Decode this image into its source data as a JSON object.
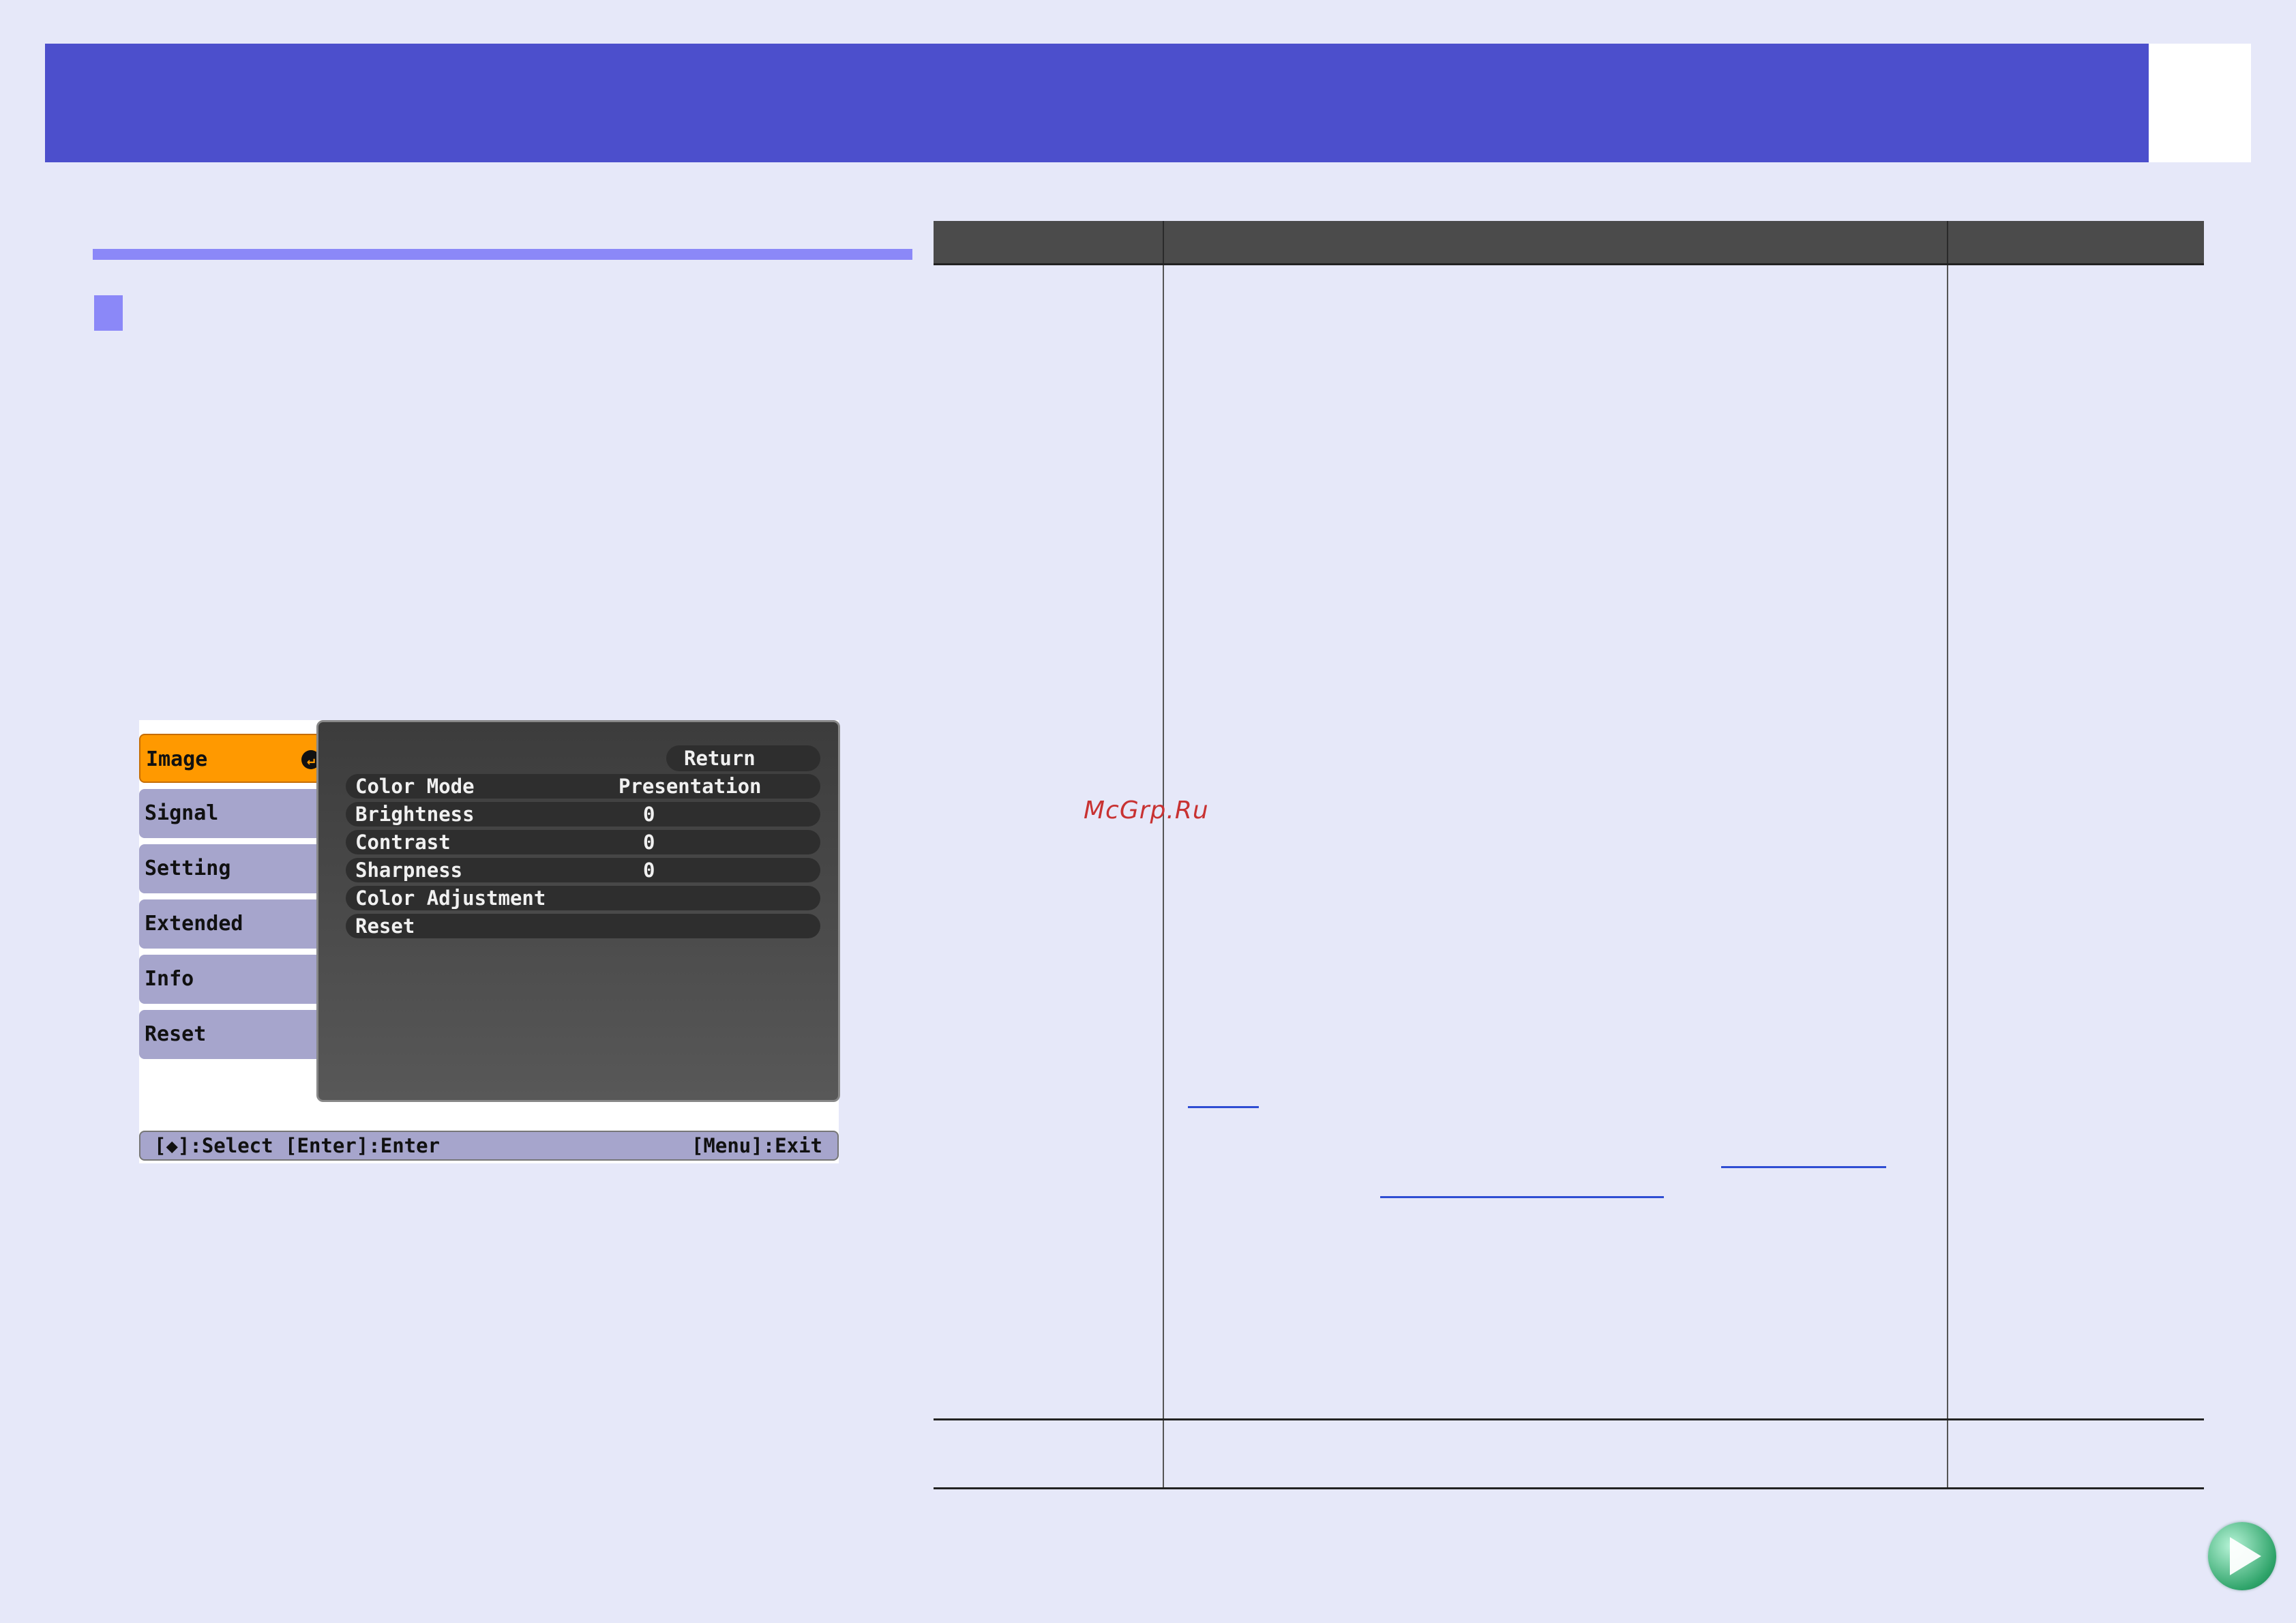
{
  "menu": {
    "nav": [
      {
        "label": "Image"
      },
      {
        "label": "Signal"
      },
      {
        "label": "Setting"
      },
      {
        "label": "Extended"
      },
      {
        "label": "Info"
      },
      {
        "label": "Reset"
      }
    ],
    "return_label": "Return",
    "rows": [
      {
        "label": "Color Mode",
        "value": "Presentation"
      },
      {
        "label": "Brightness",
        "value": "0"
      },
      {
        "label": "Contrast",
        "value": "0"
      },
      {
        "label": "Sharpness",
        "value": "0"
      },
      {
        "label": "Color Adjustment",
        "value": ""
      },
      {
        "label": "Reset",
        "value": ""
      }
    ],
    "footer_left": "[◆]:Select [Enter]:Enter",
    "footer_right": "[Menu]:Exit"
  },
  "watermark": "McGrp.Ru",
  "colors": {
    "header": "#4c4fcc",
    "accent": "#8b88f8",
    "active_tab": "#ff9900",
    "link": "#2f4dd3"
  },
  "icons": [
    "enter-icon",
    "next-page-arrow-icon"
  ]
}
